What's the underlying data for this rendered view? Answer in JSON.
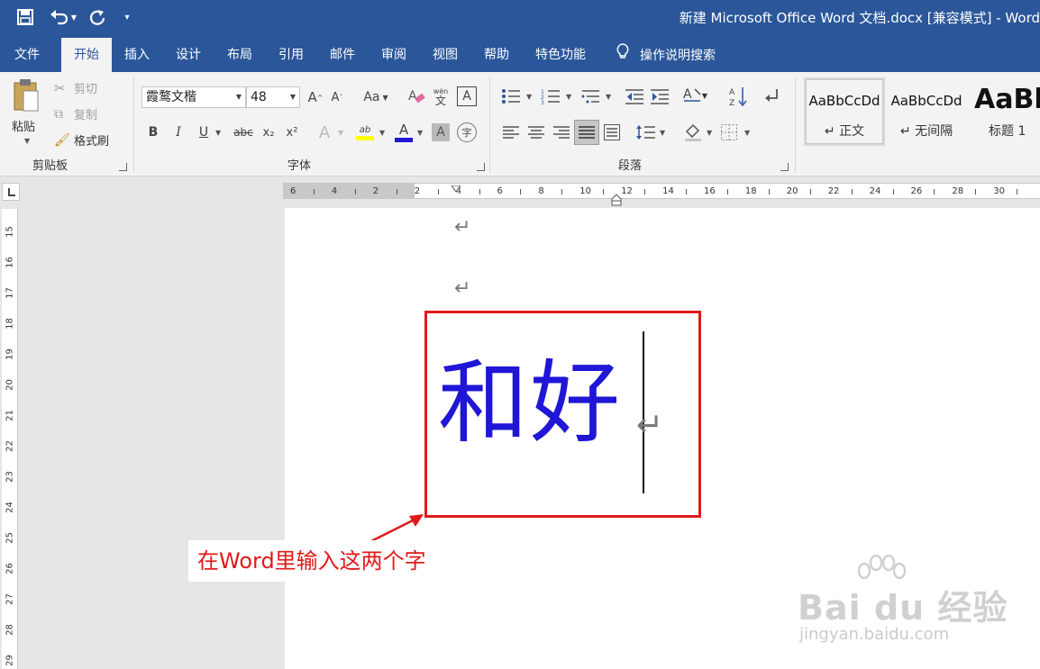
{
  "titlebar": {
    "title": "新建 Microsoft Office Word 文档.docx [兼容模式]  -  Word",
    "qa_save_icon": "save-icon",
    "qa_undo_icon": "undo-icon",
    "qa_redo_icon": "redo-icon",
    "qa_customize_icon": "customize-icon"
  },
  "tabs": [
    {
      "label": "文件"
    },
    {
      "label": "开始"
    },
    {
      "label": "插入"
    },
    {
      "label": "设计"
    },
    {
      "label": "布局"
    },
    {
      "label": "引用"
    },
    {
      "label": "邮件"
    },
    {
      "label": "审阅"
    },
    {
      "label": "视图"
    },
    {
      "label": "帮助"
    },
    {
      "label": "特色功能"
    }
  ],
  "tell_me": "操作说明搜索",
  "clipboard": {
    "paste": "粘贴",
    "cut": "剪切",
    "copy": "复制",
    "format_painter": "格式刷",
    "group_label": "剪贴板"
  },
  "font": {
    "font_name": "霞鹜文楷",
    "font_size": "48",
    "group_label": "字体",
    "bold": "B",
    "italic": "I",
    "underline": "U",
    "strike": "abc",
    "sub": "x₂",
    "sup": "x²",
    "grow": "A",
    "shrink": "A",
    "case": "Aa",
    "phonetic": "文",
    "border_char": "A",
    "effects": "A",
    "highlight": "ab",
    "font_color": "A",
    "char_shade": "A",
    "enclose": "字"
  },
  "paragraph": {
    "group_label": "段落"
  },
  "styles": [
    {
      "sample": "AaBbCcDd",
      "name": "↵ 正文"
    },
    {
      "sample": "AaBbCcDd",
      "name": "↵ 无间隔"
    },
    {
      "sample": "AaBb",
      "name": "标题 1"
    }
  ],
  "ruler": {
    "h_ticks": [
      "6",
      "4",
      "2",
      "2",
      "4",
      "6",
      "8",
      "10",
      "12",
      "14",
      "16",
      "18",
      "20",
      "22",
      "24",
      "26",
      "28",
      "30"
    ],
    "v_ticks": [
      "15",
      "16",
      "17",
      "18",
      "19",
      "20",
      "21",
      "22",
      "23",
      "24",
      "25",
      "26",
      "27",
      "28",
      "29"
    ]
  },
  "document": {
    "typed_text": "和好",
    "para_mark": "↵"
  },
  "annotation": {
    "text": "在Word里输入这两个字"
  },
  "watermark": {
    "main": "Bai du 经验",
    "sub": "jingyan.baidu.com"
  },
  "colors": {
    "accent": "#2b579a",
    "highlight_box": "#e01a1a",
    "doc_text": "#1f16d6"
  }
}
